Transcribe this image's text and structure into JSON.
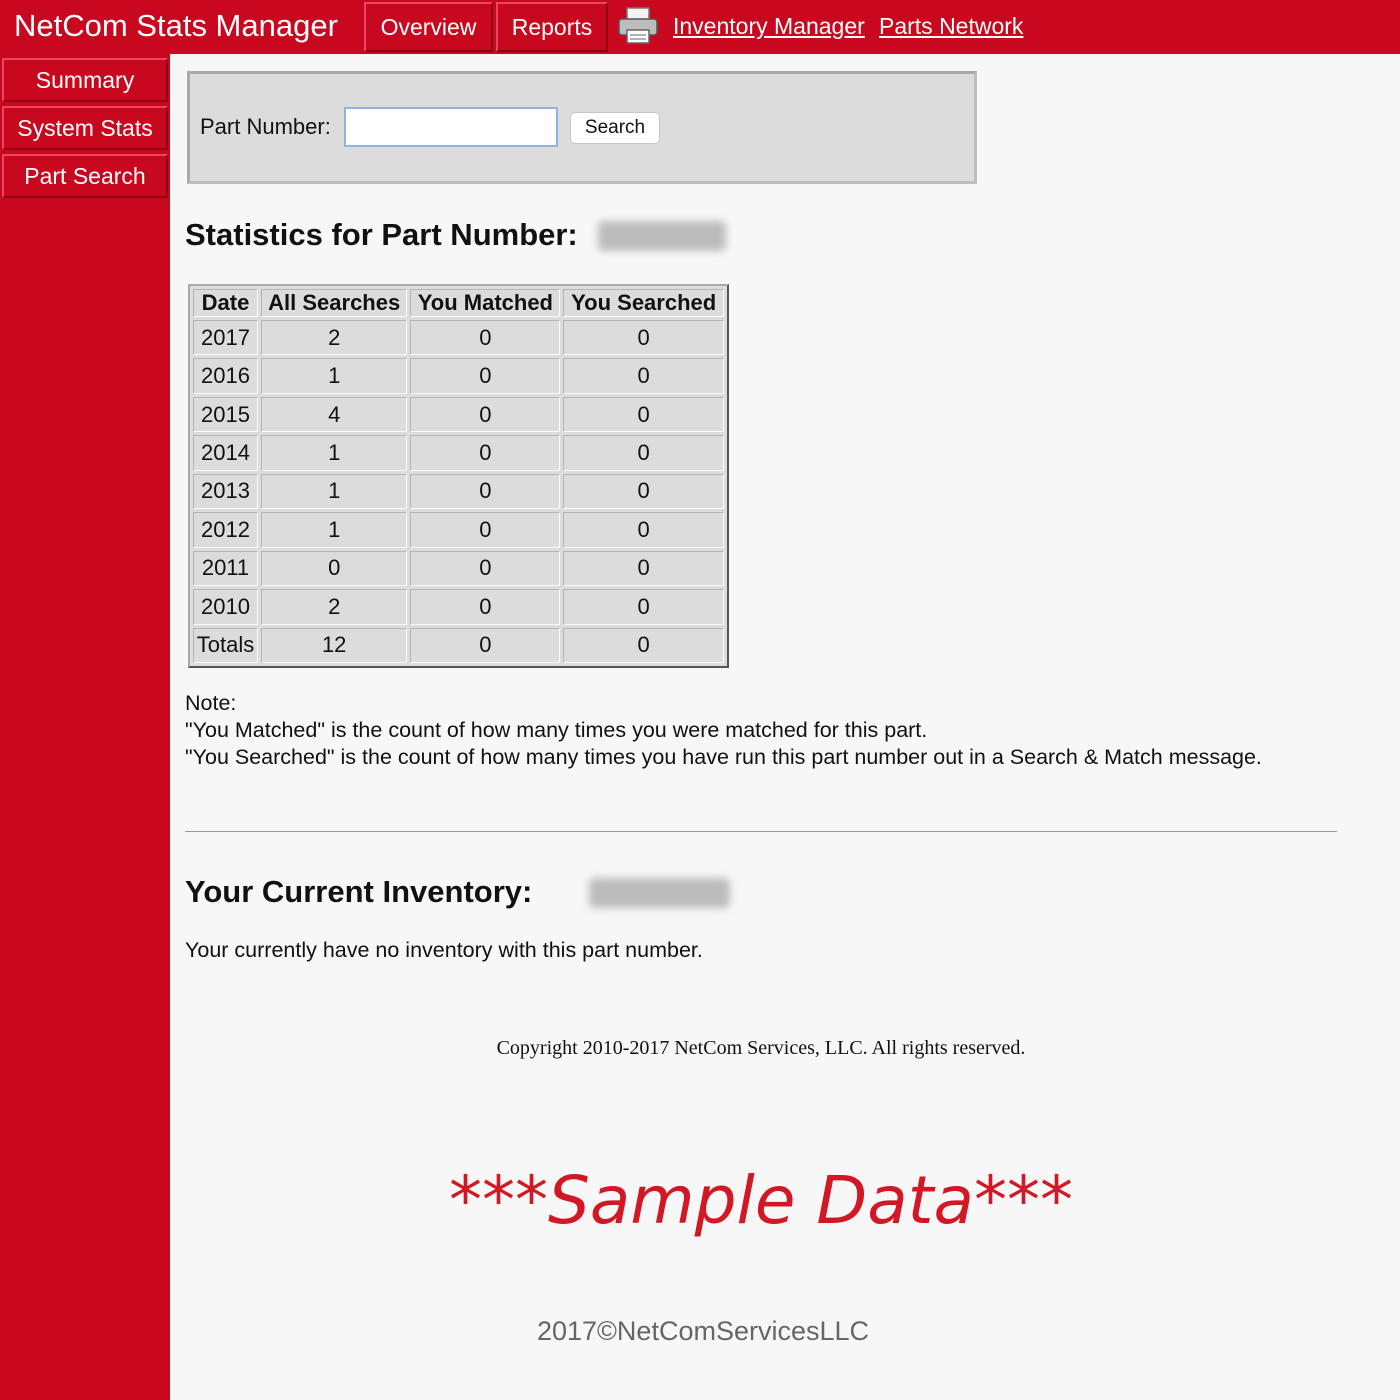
{
  "header": {
    "app_title": "NetCom Stats Manager",
    "tabs": [
      {
        "label": "Overview"
      },
      {
        "label": "Reports"
      }
    ],
    "print_icon": "printer-icon",
    "links": [
      {
        "label": "Inventory Manager"
      },
      {
        "label": "Parts Network"
      }
    ]
  },
  "sidebar": {
    "items": [
      {
        "label": "Summary"
      },
      {
        "label": "System Stats"
      },
      {
        "label": "Part Search"
      }
    ]
  },
  "search": {
    "label": "Part Number:",
    "value": "",
    "placeholder": "",
    "button_label": "Search"
  },
  "stats": {
    "heading": "Statistics for Part Number:",
    "columns": [
      "Date",
      "All Searches",
      "You Matched",
      "You Searched"
    ],
    "rows": [
      [
        "2017",
        "2",
        "0",
        "0"
      ],
      [
        "2016",
        "1",
        "0",
        "0"
      ],
      [
        "2015",
        "4",
        "0",
        "0"
      ],
      [
        "2014",
        "1",
        "0",
        "0"
      ],
      [
        "2013",
        "1",
        "0",
        "0"
      ],
      [
        "2012",
        "1",
        "0",
        "0"
      ],
      [
        "2011",
        "0",
        "0",
        "0"
      ],
      [
        "2010",
        "2",
        "0",
        "0"
      ],
      [
        "Totals",
        "12",
        "0",
        "0"
      ]
    ]
  },
  "note": {
    "title": "Note:",
    "lines": [
      "\"You Matched\" is the count of how many times you were matched for this part.",
      "\"You Searched\" is the count of how many times you have run this part number out in a Search & Match message."
    ]
  },
  "inventory": {
    "heading": "Your Current Inventory:",
    "message": "Your currently have no inventory with this part number."
  },
  "copyright": "Copyright 2010-2017 NetCom Services, LLC. All rights reserved.",
  "watermark": "***Sample Data***",
  "footer": "2017©NetComServicesLLC",
  "colors": {
    "brand_red": "#c8081f",
    "watermark_red": "#d21725",
    "panel_gray": "#dcdcdc"
  }
}
